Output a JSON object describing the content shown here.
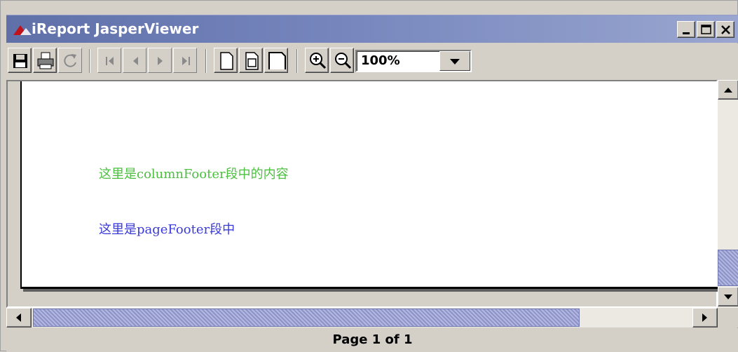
{
  "window": {
    "title": "iReport JasperViewer"
  },
  "toolbar": {
    "buttons": [
      {
        "name": "save",
        "icon": "floppy-disk-icon"
      },
      {
        "name": "print",
        "icon": "printer-icon"
      },
      {
        "name": "reload",
        "icon": "reload-icon"
      },
      {
        "name": "first-page",
        "icon": "first-page-icon"
      },
      {
        "name": "previous-page",
        "icon": "previous-page-icon"
      },
      {
        "name": "next-page",
        "icon": "next-page-icon"
      },
      {
        "name": "last-page",
        "icon": "last-page-icon"
      },
      {
        "name": "actual-size",
        "icon": "page-icon"
      },
      {
        "name": "fit-page",
        "icon": "fit-page-icon"
      },
      {
        "name": "fit-width",
        "icon": "fit-width-icon"
      },
      {
        "name": "zoom-in",
        "icon": "zoom-in-icon"
      },
      {
        "name": "zoom-out",
        "icon": "zoom-out-icon"
      }
    ],
    "zoom": "100%"
  },
  "report": {
    "column_footer_text": "这里是columnFooter段中的内容",
    "page_footer_text": "这里是pageFooter段中"
  },
  "colors": {
    "column_footer": "#4cbf40",
    "page_footer": "#3a3ad8",
    "title_bar": "#6f7fb8"
  },
  "status": {
    "page_info": "Page 1 of 1"
  }
}
